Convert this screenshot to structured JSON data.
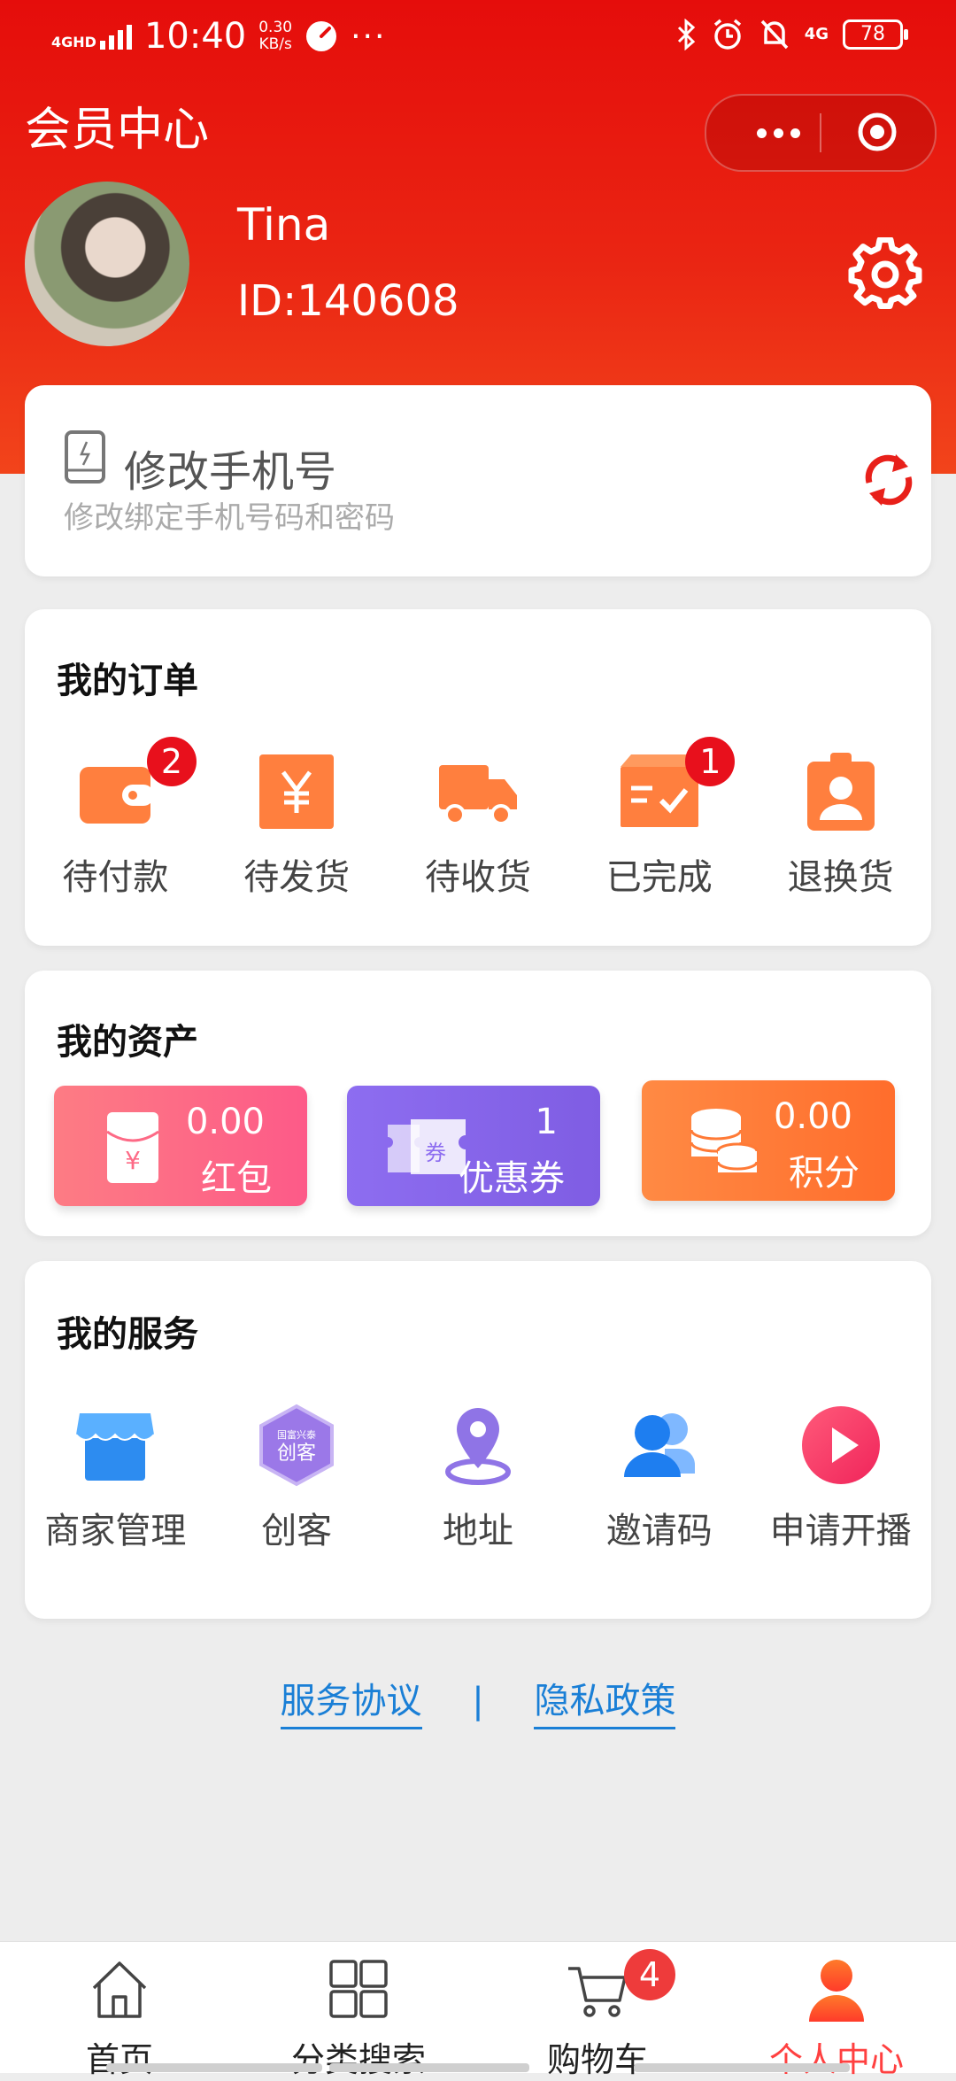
{
  "status_bar": {
    "network": "4GHD",
    "time": "10:40",
    "speed_value": "0.30",
    "speed_unit": "KB/s",
    "overflow": "···",
    "network_right": "4G",
    "battery": "78"
  },
  "header": {
    "title": "会员中心",
    "user_name": "Tina",
    "user_id": "ID:140608"
  },
  "phone_card": {
    "title": "修改手机号",
    "subtitle": "修改绑定手机号码和密码"
  },
  "orders": {
    "title": "我的订单",
    "items": [
      {
        "label": "待付款",
        "badge": "2",
        "icon": "wallet-icon"
      },
      {
        "label": "待发货",
        "icon": "yen-box-icon"
      },
      {
        "label": "待收货",
        "icon": "truck-icon"
      },
      {
        "label": "已完成",
        "badge": "1",
        "icon": "completed-box-icon"
      },
      {
        "label": "退换货",
        "icon": "badge-person-icon"
      }
    ]
  },
  "assets": {
    "title": "我的资产",
    "items": [
      {
        "value": "0.00",
        "label": "红包",
        "icon": "red-envelope-icon"
      },
      {
        "value": "1",
        "label": "优惠券",
        "icon": "coupon-icon",
        "icon_text": "券"
      },
      {
        "value": "0.00",
        "label": "积分",
        "icon": "coins-icon"
      }
    ]
  },
  "services": {
    "title": "我的服务",
    "items": [
      {
        "label": "商家管理",
        "icon": "store-icon"
      },
      {
        "label": "创客",
        "icon": "maker-hexagon-icon",
        "icon_text_top": "国富兴泰",
        "icon_text": "创客"
      },
      {
        "label": "地址",
        "icon": "location-pin-icon"
      },
      {
        "label": "邀请码",
        "icon": "users-icon"
      },
      {
        "label": "申请开播",
        "icon": "play-icon"
      }
    ]
  },
  "links": {
    "agreement": "服务协议",
    "separator": "|",
    "privacy": "隐私政策"
  },
  "tabbar": {
    "items": [
      {
        "label": "首页",
        "icon": "home-icon"
      },
      {
        "label": "分类搜索",
        "icon": "grid-icon"
      },
      {
        "label": "购物车",
        "icon": "cart-icon",
        "badge": "4"
      },
      {
        "label": "个人中心",
        "icon": "person-icon",
        "active": true
      }
    ]
  },
  "colors": {
    "header_red": "#e50d0b",
    "order_orange": "#ff7f3e",
    "tab_active": "#ff4040",
    "link_blue": "#1a7fd6"
  }
}
